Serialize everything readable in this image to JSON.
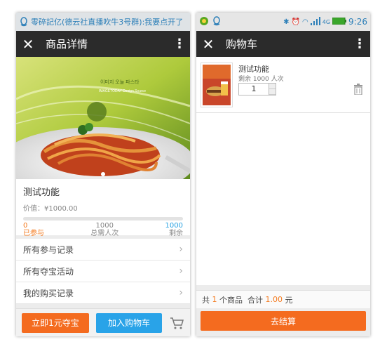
{
  "left": {
    "status_text": "零碎記亿(德云社直播吹牛3号群):我要点开了",
    "title": "商品详情",
    "hero_text": {
      "line1": "IMAGETODAY Design Source",
      "korean": "이미지 오늘 파스타"
    },
    "product_name": "测试功能",
    "price": "价值：¥1000.00",
    "progress_fraction": 0.0,
    "counts": [
      {
        "value": "0",
        "label": "已参与",
        "color": "orange"
      },
      {
        "value": "1000",
        "label": "总需人次",
        "color": "grey"
      },
      {
        "value": "1000",
        "label": "剩余",
        "color": "blue"
      }
    ],
    "menu": [
      {
        "label": "所有参与记录"
      },
      {
        "label": "所有夺宝活动"
      },
      {
        "label": "我的购买记录"
      }
    ],
    "buy_button": "立即1元夺宝",
    "add_cart_button": "加入购物车"
  },
  "right": {
    "status_time": "9:26",
    "status_net": "4G",
    "title": "购物车",
    "item_name": "测试功能",
    "item_remain": "剩余 1000 人次",
    "item_qty": "1",
    "summary": {
      "prefix": "共",
      "count": "1",
      "mid": "个商品  合计",
      "total": "1.00",
      "unit": "元"
    },
    "checkout_button": "去结算"
  },
  "colors": {
    "orange": "#f46b1f",
    "blue": "#29a3e8",
    "titlebar": "#2b2b2b"
  }
}
